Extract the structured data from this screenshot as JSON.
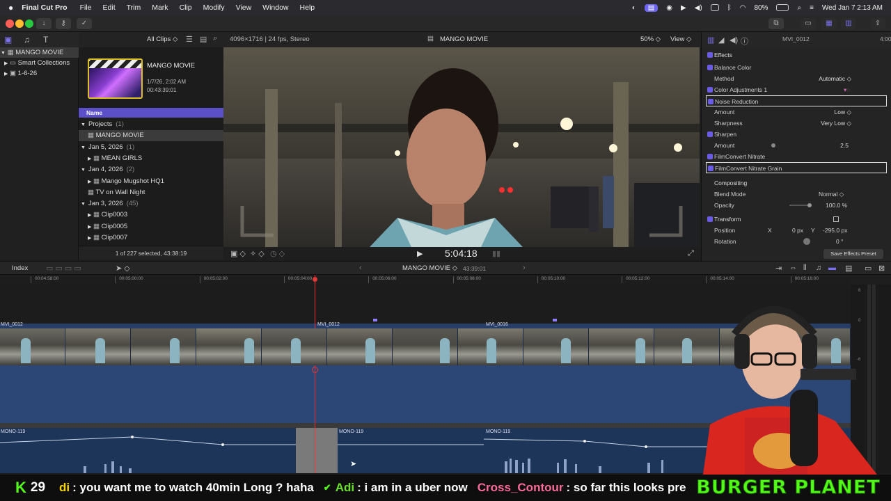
{
  "menubar": {
    "app_name": "Final Cut Pro",
    "items": [
      "File",
      "Edit",
      "Trim",
      "Mark",
      "Clip",
      "Modify",
      "View",
      "Window",
      "Help"
    ],
    "battery": "80%",
    "clock": "Wed Jan 7  2:13 AM"
  },
  "library": {
    "items": [
      {
        "label": "MANGO MOVIE",
        "selected": true
      },
      {
        "label": "Smart Collections"
      },
      {
        "label": "1-6-26"
      }
    ]
  },
  "browser": {
    "filter": "All Clips",
    "project_card": {
      "title": "MANGO MOVIE",
      "date": "1/7/26, 2:02 AM",
      "duration": "00:43:39:01"
    },
    "column_header": "Name",
    "rows": [
      {
        "label": "Projects",
        "count": "(1)",
        "kind": "group"
      },
      {
        "label": "MANGO MOVIE",
        "kind": "item",
        "selected": true
      },
      {
        "label": "Jan 5, 2026",
        "count": "(1)",
        "kind": "group"
      },
      {
        "label": "MEAN GIRLS",
        "kind": "item"
      },
      {
        "label": "Jan 4, 2026",
        "count": "(2)",
        "kind": "group"
      },
      {
        "label": "Mango Mugshot HQ1",
        "kind": "item"
      },
      {
        "label": "TV on Wall Night",
        "kind": "item"
      },
      {
        "label": "Jan 3, 2026",
        "count": "(45)",
        "kind": "group"
      },
      {
        "label": "Clip0003",
        "kind": "item"
      },
      {
        "label": "Clip0005",
        "kind": "item"
      },
      {
        "label": "Clip0007",
        "kind": "item"
      }
    ],
    "footer": "1 of 227 selected, 43:38:19"
  },
  "viewer": {
    "format": "4096×1716 | 24 fps, Stereo",
    "title": "MANGO MOVIE",
    "zoom": "50%",
    "view_menu": "View",
    "timecode": "5:04:18"
  },
  "inspector": {
    "clip_name": "MVI_0012",
    "duration": "4:00",
    "effects_header": "Effects",
    "rows": [
      {
        "label": "Balance Color",
        "checkbox": true
      },
      {
        "label": "Method",
        "value": "Automatic ◇",
        "indent": true
      },
      {
        "label": "Color Adjustments 1",
        "checkbox": true
      },
      {
        "label": "Noise Reduction",
        "checkbox": true,
        "boxed": true
      },
      {
        "label": "Amount",
        "value": "Low ◇",
        "indent": true
      },
      {
        "label": "Sharpness",
        "value": "Very Low ◇",
        "indent": true
      },
      {
        "label": "Sharpen",
        "checkbox": true
      },
      {
        "label": "Amount",
        "value": "2.5",
        "indent": true,
        "slider": true
      },
      {
        "label": "FilmConvert Nitrate",
        "checkbox": true
      },
      {
        "label": "FilmConvert Nitrate Grain",
        "checkbox": true,
        "boxed": true
      }
    ],
    "compositing": {
      "header": "Compositing",
      "blend_label": "Blend Mode",
      "blend_value": "Normal ◇",
      "opacity_label": "Opacity",
      "opacity_value": "100.0 %"
    },
    "transform": {
      "header": "Transform",
      "position_label": "Position",
      "x_label": "X",
      "x_value": "0 px",
      "y_label": "Y",
      "y_value": "-295.0 px",
      "rotation_label": "Rotation",
      "rotation_value": "0 °"
    },
    "save_preset": "Save Effects Preset"
  },
  "timeline": {
    "index_label": "Index",
    "project": "MANGO MOVIE",
    "duration": "43:39:01",
    "ruler_ticks": [
      "00:04:58:00",
      "00:05:00:00",
      "00:05:02:00",
      "00:05:04:00",
      "00:05:06:00",
      "00:05:08:00",
      "00:05:10:00",
      "00:05:12:00",
      "00:05:14:00",
      "00:05:16:00"
    ],
    "video_clips": [
      "MVI_0012",
      "MVI_0012",
      "MVI_0016"
    ],
    "audio_clips": [
      "MONO-119",
      "MONO-119",
      "MONO-119"
    ],
    "meter_labels": [
      "6",
      "0",
      "-6"
    ]
  },
  "chat": {
    "viewer_count": "29",
    "messages": [
      {
        "user": "di",
        "text": ": you want me to watch 40min Long ? haha",
        "color": "#f5d400"
      },
      {
        "user": "Adi",
        "text": ": i am in a uber now",
        "color": "#6be12c"
      },
      {
        "user": "Cross_Contour",
        "text": ": so far this looks pretty pro",
        "color": "#ff6b9b"
      }
    ],
    "banner": "BURGER PLANET"
  }
}
